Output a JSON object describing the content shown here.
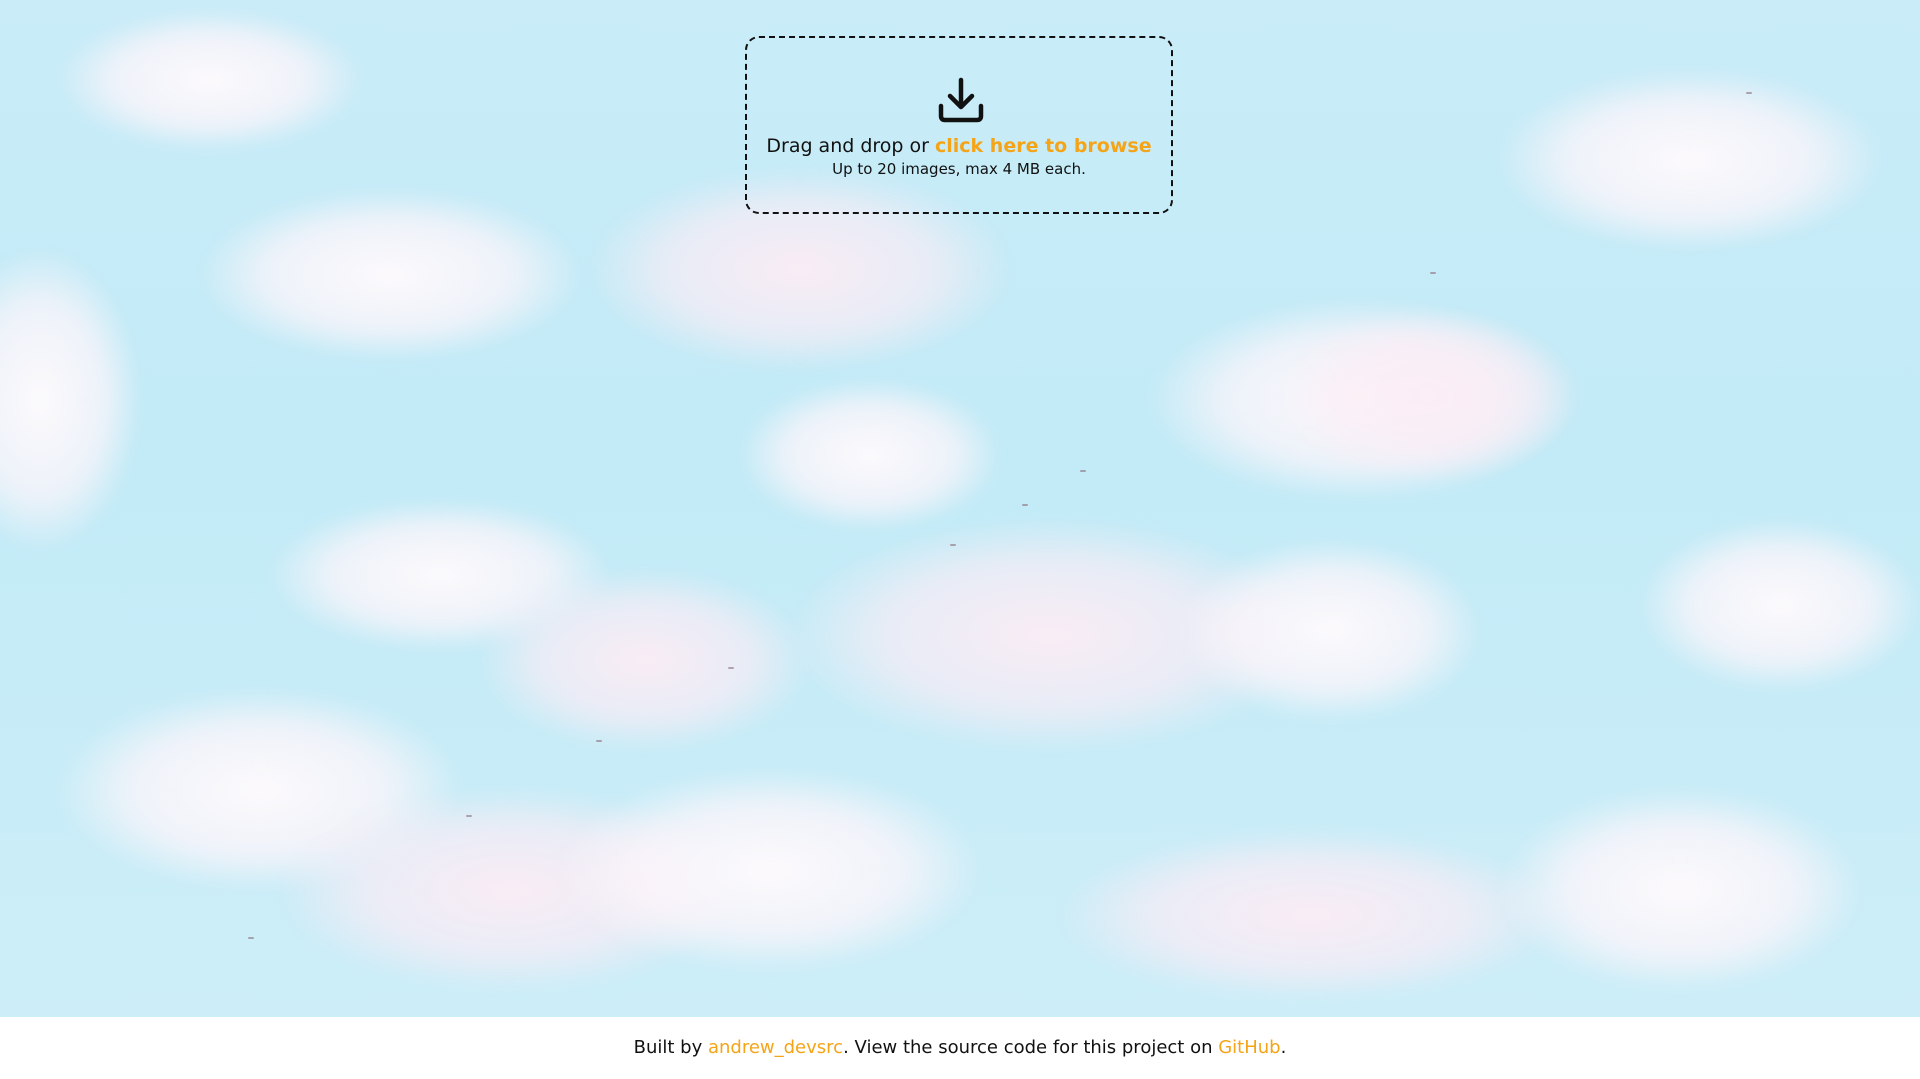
{
  "upload": {
    "icon": "download-tray-icon",
    "text_prefix": "Drag and drop or ",
    "browse_link": "click here to browse",
    "limits_text": "Up to 20 images, max 4 MB each."
  },
  "footer": {
    "prefix": "Built by ",
    "author_link": "andrew_devsrc",
    "middle": ". View the source code for this project on ",
    "github_link": "GitHub",
    "suffix": "."
  },
  "colors": {
    "accent": "#f5a418",
    "text": "#111111",
    "sky": "#c2ebf7",
    "footer_bg": "#ffffff"
  }
}
